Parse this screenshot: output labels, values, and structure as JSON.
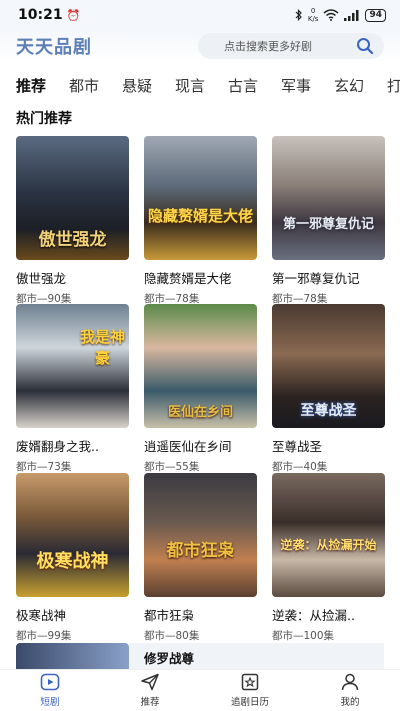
{
  "status": {
    "time": "10:21",
    "speed_top": "0",
    "speed_bottom": "K/s",
    "battery": "94"
  },
  "header": {
    "app_title": "天天品剧",
    "search_placeholder": "点击搜索更多好剧"
  },
  "tabs": [
    "推荐",
    "都市",
    "悬疑",
    "现言",
    "古言",
    "军事",
    "玄幻",
    "打"
  ],
  "section_title": "热门推荐",
  "cards": [
    {
      "title": "傲世强龙",
      "meta": "都市—90集",
      "poster_text": "傲世强龙"
    },
    {
      "title": "隐藏赘婿是大佬",
      "meta": "都市—78集",
      "poster_text": "隐藏赘婿是大佬"
    },
    {
      "title": "第一邪尊复仇记",
      "meta": "都市—78集",
      "poster_text": "第一邪尊复仇记"
    },
    {
      "title": "废婿翻身之我..",
      "meta": "都市—73集",
      "poster_text": "我是神豪"
    },
    {
      "title": "逍遥医仙在乡间",
      "meta": "都市—55集",
      "poster_text": "医仙在乡间"
    },
    {
      "title": "至尊战圣",
      "meta": "都市—40集",
      "poster_text": "至尊战圣"
    },
    {
      "title": "极寒战神",
      "meta": "都市—99集",
      "poster_text": "极寒战神"
    },
    {
      "title": "都市狂枭",
      "meta": "都市—80集",
      "poster_text": "都市狂枭"
    },
    {
      "title": "逆袭：从捡漏..",
      "meta": "都市—100集",
      "poster_text": "逆袭：从捡漏开始"
    }
  ],
  "next_title": "修罗战尊",
  "bottom_nav": [
    {
      "label": "短剧",
      "icon": "play-icon"
    },
    {
      "label": "推荐",
      "icon": "send-icon"
    },
    {
      "label": "追剧日历",
      "icon": "calendar-star-icon"
    },
    {
      "label": "我的",
      "icon": "user-icon"
    }
  ],
  "colors": {
    "accent": "#3b63c4",
    "title": "#5d7fb8"
  }
}
